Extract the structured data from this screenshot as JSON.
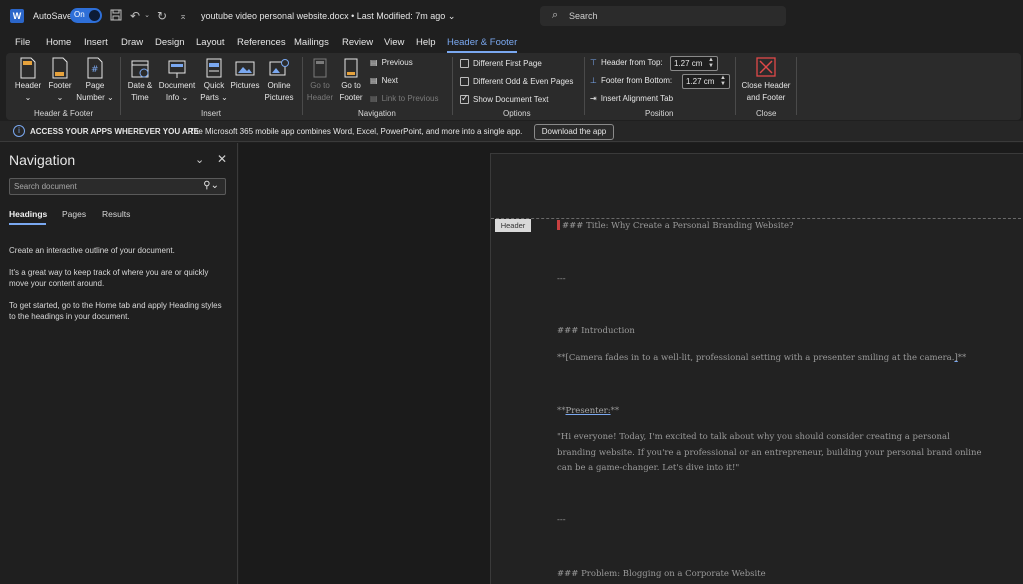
{
  "titlebar": {
    "app_logo": "W",
    "autosave_label": "AutoSave",
    "autosave_state": "On",
    "document_title": "youtube video personal website.docx • Last Modified: 7m ago",
    "search_placeholder": "Search",
    "icons": [
      "save-icon",
      "undo-icon",
      "redo-icon",
      "customize-qat-icon"
    ]
  },
  "menu": {
    "tabs": [
      "File",
      "Home",
      "Insert",
      "Draw",
      "Design",
      "Layout",
      "References",
      "Mailings",
      "Review",
      "View",
      "Help",
      "Header & Footer"
    ],
    "active": "Header & Footer"
  },
  "ribbon": {
    "groups": {
      "header_footer": {
        "label": "Header & Footer",
        "header": "Header",
        "footer": "Footer",
        "page_number_1": "Page",
        "page_number_2": "Number"
      },
      "insert": {
        "label": "Insert",
        "date_time_1": "Date &",
        "date_time_2": "Time",
        "doc_info_1": "Document",
        "doc_info_2": "Info",
        "quick_parts_1": "Quick",
        "quick_parts_2": "Parts",
        "pictures": "Pictures",
        "online_pictures_1": "Online",
        "online_pictures_2": "Pictures"
      },
      "navigation": {
        "label": "Navigation",
        "go_to_header_1": "Go to",
        "go_to_header_2": "Header",
        "go_to_footer_1": "Go to",
        "go_to_footer_2": "Footer",
        "previous": "Previous",
        "next": "Next",
        "link_to_previous": "Link to Previous"
      },
      "options": {
        "label": "Options",
        "different_first_page": "Different First Page",
        "different_odd_even": "Different Odd & Even Pages",
        "show_document_text": "Show Document Text",
        "show_document_text_checked": true
      },
      "position": {
        "label": "Position",
        "header_from_top": "Header from Top:",
        "header_from_top_value": "1.27 cm",
        "footer_from_bottom": "Footer from Bottom:",
        "footer_from_bottom_value": "1.27 cm",
        "insert_alignment_tab": "Insert Alignment Tab"
      },
      "close": {
        "label": "Close",
        "close_1": "Close Header",
        "close_2": "and Footer"
      }
    }
  },
  "infobar": {
    "bold_text": "ACCESS YOUR APPS WHEREVER YOU ARE",
    "text": "The Microsoft 365 mobile app combines Word, Excel, PowerPoint, and more into a single app.",
    "button": "Download the app"
  },
  "navigation_pane": {
    "title": "Navigation",
    "search_placeholder": "Search document",
    "tabs": [
      "Headings",
      "Pages",
      "Results"
    ],
    "active_tab": "Headings",
    "paragraphs": [
      "Create an interactive outline of your document.",
      "It's a great way to keep track of where you are or quickly move your content around.",
      "To get started, go to the Home tab and apply Heading styles to the headings in your document."
    ]
  },
  "document": {
    "header_tag": "Header",
    "lines": {
      "title": "### Title: Why Create a Personal Branding Website?",
      "sep1": "---",
      "intro": "### Introduction",
      "camera_pre": "**[Camera fades in to a well-lit, professional setting with a presenter smiling at the camera.",
      "camera_bracket": "]",
      "camera_post": "**",
      "presenter_pre": "**",
      "presenter": "Presenter:",
      "presenter_post": "**",
      "quote": "\"Hi everyone! Today, I'm excited to talk about why you should consider creating a personal branding website. If you're a professional or an entrepreneur, building your personal brand online can be a game-changer. Let's dive into it!\"",
      "sep2": "---",
      "problem": "### Problem: Blogging on a Corporate Website"
    }
  },
  "colors": {
    "accent": "#7aa8f0",
    "toggle_on": "#2e6fd8",
    "close_red": "#e04848"
  }
}
